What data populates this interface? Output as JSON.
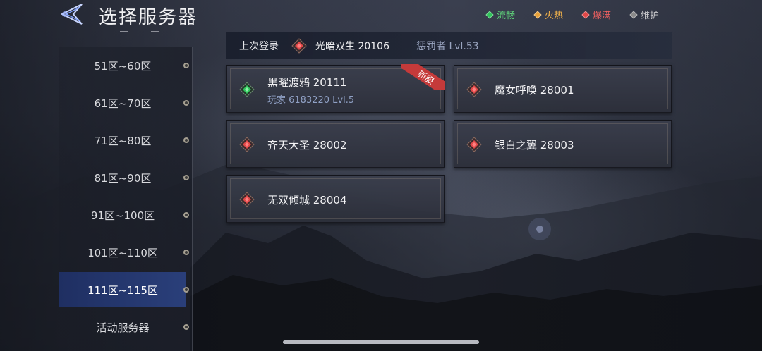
{
  "header": {
    "title": "选择服务器"
  },
  "legend": [
    {
      "label": "流畅",
      "color": "#2fc35a",
      "text_color": "#5fd27a"
    },
    {
      "label": "火热",
      "color": "#e8a23a",
      "text_color": "#f0b14a"
    },
    {
      "label": "爆满",
      "color": "#e04848",
      "text_color": "#ef6060"
    },
    {
      "label": "维护",
      "color": "#8a8a8a",
      "text_color": "#c9c9cc"
    }
  ],
  "sidebar": {
    "items": [
      {
        "label": "51区~60区"
      },
      {
        "label": "61区~70区"
      },
      {
        "label": "71区~80区"
      },
      {
        "label": "81区~90区"
      },
      {
        "label": "91区~100区"
      },
      {
        "label": "101区~110区"
      },
      {
        "label": "111区~115区",
        "active": true
      },
      {
        "label": "活动服务器"
      }
    ]
  },
  "last_login": {
    "label": "上次登录",
    "server": "光暗双生 20106",
    "player": "惩罚者 Lvl.53",
    "status": "爆满"
  },
  "servers": [
    {
      "name": "黑曜渡鸦 20111",
      "sub": "玩家 6183220 Lvl.5",
      "status": "流畅",
      "badge": "新服"
    },
    {
      "name": "魔女呼唤 28001",
      "status": "爆满"
    },
    {
      "name": "齐天大圣 28002",
      "status": "爆满"
    },
    {
      "name": "银白之翼 28003",
      "status": "爆满"
    },
    {
      "name": "无双倾城 28004",
      "status": "爆满"
    }
  ]
}
